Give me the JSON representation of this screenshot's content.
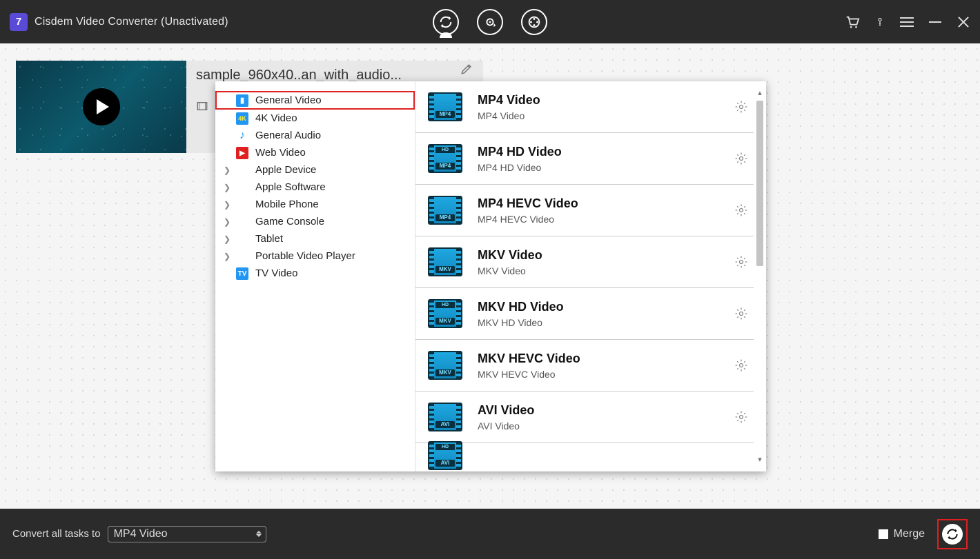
{
  "app": {
    "logo_letter": "7",
    "title": "Cisdem Video Converter (Unactivated)"
  },
  "task": {
    "filename": "sample_960x40..an_with_audio..."
  },
  "categories": [
    {
      "label": "General Video",
      "icon": "film-icon",
      "selected": true
    },
    {
      "label": "4K Video",
      "icon": "4k-icon"
    },
    {
      "label": "General Audio",
      "icon": "audio-icon"
    },
    {
      "label": "Web Video",
      "icon": "web-icon"
    },
    {
      "label": "Apple Device",
      "chevron": true
    },
    {
      "label": "Apple Software",
      "chevron": true
    },
    {
      "label": "Mobile Phone",
      "chevron": true
    },
    {
      "label": "Game Console",
      "chevron": true
    },
    {
      "label": "Tablet",
      "chevron": true
    },
    {
      "label": "Portable Video Player",
      "chevron": true
    },
    {
      "label": "TV Video",
      "icon": "tv-icon"
    }
  ],
  "formats": [
    {
      "title": "MP4 Video",
      "sub": "MP4 Video",
      "tag": "MP4"
    },
    {
      "title": "MP4 HD Video",
      "sub": "MP4 HD Video",
      "tag": "MP4",
      "hd": "HD"
    },
    {
      "title": "MP4 HEVC Video",
      "sub": "MP4 HEVC Video",
      "tag": "MP4"
    },
    {
      "title": "MKV Video",
      "sub": "MKV Video",
      "tag": "MKV"
    },
    {
      "title": "MKV HD Video",
      "sub": "MKV HD Video",
      "tag": "MKV",
      "hd": "HD"
    },
    {
      "title": "MKV HEVC Video",
      "sub": "MKV HEVC Video",
      "tag": "MKV"
    },
    {
      "title": "AVI Video",
      "sub": "AVI Video",
      "tag": "AVI"
    }
  ],
  "bottom": {
    "convert_label": "Convert all tasks to",
    "selected_format": "MP4 Video",
    "merge_label": "Merge"
  }
}
